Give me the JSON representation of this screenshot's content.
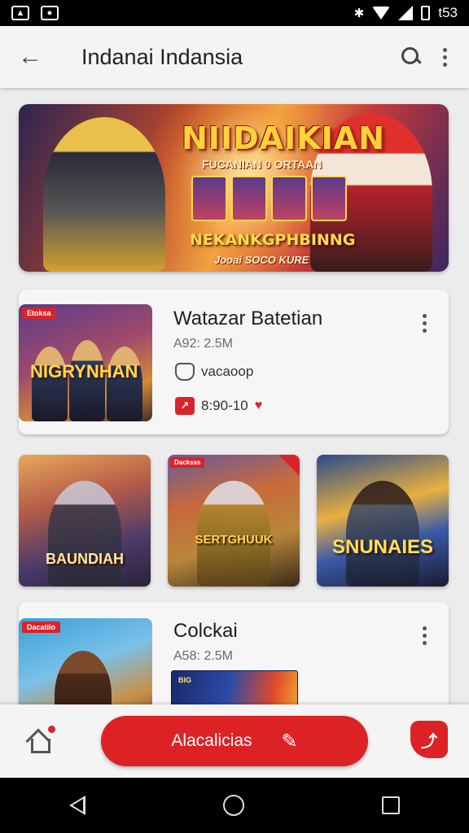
{
  "status_bar": {
    "time": "t53"
  },
  "app_bar": {
    "title": "Indanai Indansia"
  },
  "banner": {
    "title": "NIIDAIKIAN",
    "subtitle": "FUCANIAN 0 ORTAAN",
    "line1": "NEKANKGPHBINNG",
    "line2": "Jooai SOCO KURE"
  },
  "card1": {
    "ribbon": "Etoksa",
    "thumb_caption": "NIGRYNHAN",
    "title": "Watazar Batetian",
    "meta": "A92: 2.5M",
    "row1_text": "vacaoop",
    "row2_text": "8:90-10"
  },
  "grid": [
    {
      "caption": "BAUNDIAH"
    },
    {
      "ribbon": "Dacksss",
      "caption": "SERTGHUUK"
    },
    {
      "caption": "SNUNAIES"
    }
  ],
  "card2": {
    "ribbon": "Dacatiio",
    "title": "Colckai",
    "meta": "A58: 2.5M",
    "mini_banner": "BIG"
  },
  "bottom_bar": {
    "cta_label": "Alacalicias"
  },
  "colors": {
    "accent": "#dd2226",
    "background": "#ececec"
  },
  "icons": [
    "back-arrow-icon",
    "search-icon",
    "more-vert-icon",
    "shield-icon",
    "heart-icon",
    "home-icon",
    "pencil-icon"
  ]
}
